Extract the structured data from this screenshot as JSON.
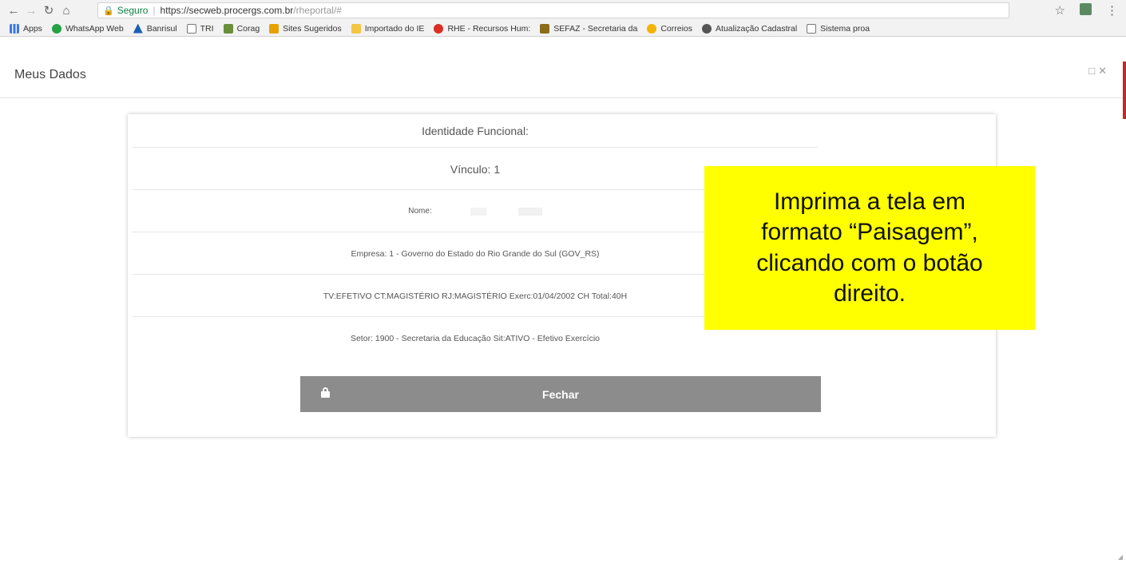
{
  "browser": {
    "security_label": "Seguro",
    "url_secure_part": "https://secweb.procergs.com.br",
    "url_path": "/rheportal/#",
    "bookmarks": [
      {
        "label": "Apps",
        "icon": "apps-icon"
      },
      {
        "label": "WhatsApp Web",
        "icon": "whatsapp-icon"
      },
      {
        "label": "Banrisul",
        "icon": "banrisul-icon"
      },
      {
        "label": "TRI",
        "icon": "page-icon"
      },
      {
        "label": "Corag",
        "icon": "corag-icon"
      },
      {
        "label": "Sites Sugeridos",
        "icon": "sites-icon"
      },
      {
        "label": "Importado do IE",
        "icon": "folder-icon"
      },
      {
        "label": "RHE - Recursos Hum:",
        "icon": "rhe-icon"
      },
      {
        "label": "SEFAZ - Secretaria da",
        "icon": "sefaz-icon"
      },
      {
        "label": "Correios",
        "icon": "correios-icon"
      },
      {
        "label": "Atualização Cadastral",
        "icon": "atualizacao-icon"
      },
      {
        "label": "Sistema proa",
        "icon": "page-icon"
      }
    ]
  },
  "page": {
    "title": "Meus Dados"
  },
  "card": {
    "identidade": "Identidade Funcional:",
    "vinculo": "Vínculo: 1",
    "nome_label": "Nome:",
    "empresa": "Empresa: 1 - Governo do Estado do Rio Grande do Sul (GOV_RS)",
    "tipo_vinculo": "TV:EFETIVO CT:MAGISTÉRIO RJ:MAGISTÉRIO Exerc:01/04/2002 CH Total:40H",
    "setor": "Setor: 1900 - Secretaria da Educação Sit:ATIVO - Efetivo Exercício",
    "close_label": "Fechar"
  },
  "annotation": {
    "text": "Imprima a tela em\nformato “Paisagem”,\nclicando com o botão\ndireito."
  },
  "colors": {
    "annotation_bg": "#ffff00",
    "button_bg": "#8c8c8c",
    "secure_green": "#0b8043"
  }
}
